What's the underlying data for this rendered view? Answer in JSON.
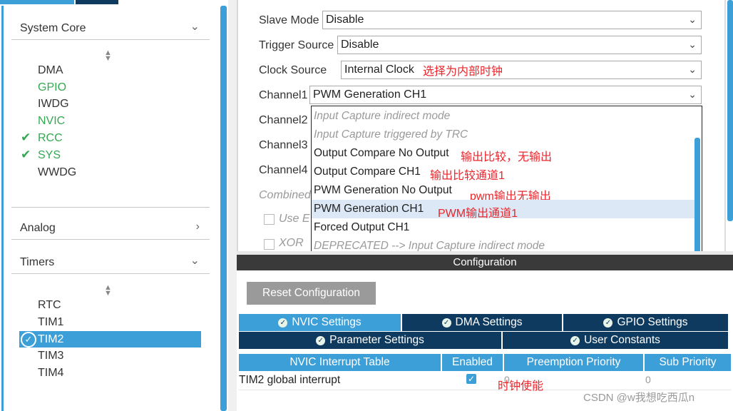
{
  "sidebar": {
    "system_core": {
      "label": "System Core",
      "items": [
        "DMA",
        "GPIO",
        "IWDG",
        "NVIC",
        "RCC",
        "SYS",
        "WWDG"
      ]
    },
    "analog": {
      "label": "Analog"
    },
    "timers": {
      "label": "Timers",
      "items": [
        "RTC",
        "TIM1",
        "TIM2",
        "TIM3",
        "TIM4"
      ]
    }
  },
  "form": {
    "slave_mode": {
      "label": "Slave Mode",
      "value": "Disable"
    },
    "trigger_source": {
      "label": "Trigger Source",
      "value": "Disable"
    },
    "clock_source": {
      "label": "Clock Source",
      "value": "Internal Clock",
      "note": "选择为内部时钟"
    },
    "channel1": {
      "label": "Channel1",
      "value": "PWM Generation CH1"
    },
    "channel2": {
      "label": "Channel2"
    },
    "channel3": {
      "label": "Channel3"
    },
    "channel4": {
      "label": "Channel4"
    },
    "combined": {
      "label": "Combined"
    },
    "use_e": {
      "label": "Use E"
    },
    "xor": {
      "label": "XOR"
    }
  },
  "dropdown": {
    "options": [
      {
        "label": "Input Capture indirect mode",
        "note": ""
      },
      {
        "label": "Input Capture triggered by TRC",
        "note": ""
      },
      {
        "label": "Output Compare No Output",
        "note": "输出比较，无输出"
      },
      {
        "label": "Output Compare CH1",
        "note": "输出比较通道1"
      },
      {
        "label": "PWM Generation No Output",
        "note": "pwm输出无输出"
      },
      {
        "label": "PWM Generation CH1",
        "note": "PWM输出通道1"
      },
      {
        "label": "Forced Output CH1",
        "note": ""
      },
      {
        "label": "DEPRECATED --> Input Capture indirect mode",
        "note": ""
      }
    ]
  },
  "config": {
    "title": "Configuration",
    "reset_button": "Reset Configuration",
    "tabs": {
      "nvic": "NVIC Settings",
      "dma": "DMA Settings",
      "gpio": "GPIO Settings",
      "parameter": "Parameter Settings",
      "user_constants": "User Constants"
    },
    "table": {
      "headers": [
        "NVIC Interrupt Table",
        "Enabled",
        "Preemption Priority",
        "Sub Priority"
      ],
      "rows": [
        {
          "name": "TIM2 global interrupt",
          "enabled": true,
          "preemption": "0",
          "sub": "0",
          "note": "时钟使能"
        }
      ]
    }
  },
  "watermark": "CSDN @w我想吃西瓜n",
  "colors": {
    "accent": "#3c9fd8",
    "dark_tab": "#0e3a5f",
    "annotation": "#e8262c",
    "enabled_green": "#34a853"
  }
}
